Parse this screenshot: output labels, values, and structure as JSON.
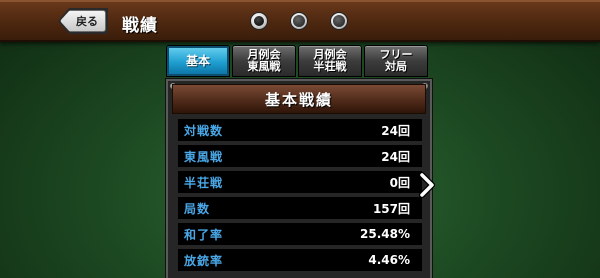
{
  "header": {
    "back_label": "戻る",
    "title": "戦績"
  },
  "pager": {
    "pages": 3,
    "current": 1
  },
  "tabs": [
    {
      "label": "基本",
      "active": true
    },
    {
      "label": "月例会\n東風戦",
      "active": false
    },
    {
      "label": "月例会\n半荘戦",
      "active": false
    },
    {
      "label": "フリー\n対局",
      "active": false
    }
  ],
  "panel": {
    "title": "基本戦績",
    "rows": [
      {
        "label": "対戦数",
        "value": "24回"
      },
      {
        "label": "東風戦",
        "value": "24回"
      },
      {
        "label": "半荘戦",
        "value": "0回"
      },
      {
        "label": "局数",
        "value": "157回"
      },
      {
        "label": "和了率",
        "value": "25.48%"
      },
      {
        "label": "放銃率",
        "value": "4.46%"
      }
    ]
  },
  "colors": {
    "label": "#4aa8e8",
    "tab_active": "#1e9ed0",
    "header_wood": "#4e2810"
  },
  "icons": {
    "next": "chevron-right-icon",
    "back": "back-arrow-icon"
  }
}
